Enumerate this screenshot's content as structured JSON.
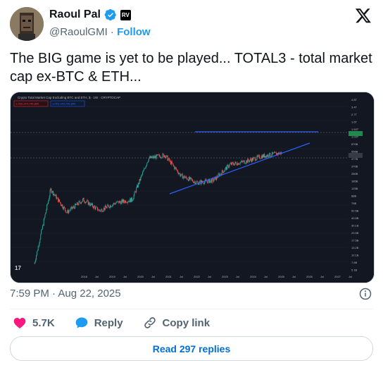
{
  "author": {
    "name": "Raoul Pal",
    "handle": "@RaoulGMI",
    "separator": "·",
    "follow_label": "Follow",
    "verified_color": "#1d9bf0",
    "affiliate_label": "RV"
  },
  "tweet": {
    "text": "The BIG game is yet to be played... TOTAL3 - total market cap ex-BTC & ETH...",
    "timestamp": "7:59 PM · Aug 22, 2025"
  },
  "chart": {
    "legend_title": "Crypto Total Market Cap Excluding BTC and ETH, $ · 1W · CRYPTOCAP",
    "price_left": "1,050,144,746,890",
    "price_right": "1,053,144,746,890",
    "x_axis_labels": [
      "2018",
      "Jul",
      "2019",
      "Jul",
      "2020",
      "Jul",
      "2021",
      "Jul",
      "2022",
      "Jul",
      "2023",
      "Jul",
      "2024",
      "Jul",
      "2025",
      "Jul",
      "2026",
      "Jul",
      "2027",
      "Jul"
    ],
    "y_axis_labels": [
      "4.8T",
      "3.4T",
      "2.7T",
      "1.6T",
      "1.53T",
      "1.03T",
      "870B",
      "556B",
      "477B",
      "370B",
      "280B",
      "185B",
      "125B",
      "88B",
      "79B",
      "52.5B",
      "40.5B",
      "30.1B",
      "23.5B",
      "17.5B",
      "13.2B",
      "10.1B",
      "7.6B",
      "5.1B"
    ],
    "tv_logo": "17",
    "chart_data": {
      "type": "line",
      "title": "Crypto Total Market Cap Excluding BTC and ETH, $ · 1W · CRYPTOCAP",
      "y_scale": "log",
      "x": [
        "2018",
        "2018.5",
        "2019",
        "2019.5",
        "2020",
        "2020.5",
        "2021",
        "2021.5",
        "2022",
        "2022.5",
        "2023",
        "2023.5",
        "2024",
        "2024.5",
        "2025",
        "2025.6"
      ],
      "series": [
        {
          "values": [
            5.1,
            180,
            60,
            110,
            65,
            95,
            110,
            800,
            950,
            350,
            250,
            280,
            600,
            700,
            900,
            1050
          ]
        }
      ],
      "trendlines": [
        {
          "type": "resistance",
          "value": 1150
        },
        {
          "type": "support",
          "from": [
            2020.9,
            110
          ],
          "to": [
            2025.6,
            900
          ]
        }
      ]
    }
  },
  "actions": {
    "likes": "5.7K",
    "reply_label": "Reply",
    "copy_label": "Copy link",
    "read_replies": "Read 297 replies"
  },
  "colors": {
    "like": "#f91880",
    "reply": "#1d9bf0",
    "muted": "#536471",
    "chart_bg": "#131722",
    "trendline": "#2962ff"
  }
}
